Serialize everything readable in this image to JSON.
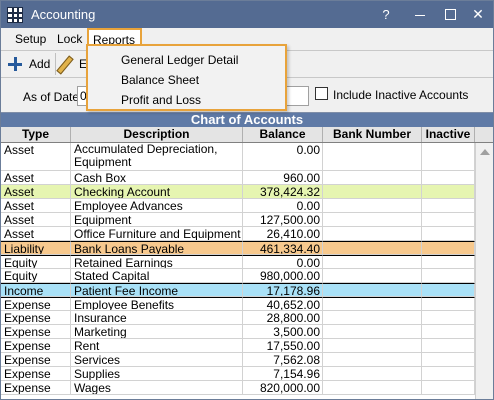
{
  "window": {
    "title": "Accounting"
  },
  "titlebar_buttons": {
    "help": "?",
    "close": "✕"
  },
  "menu": {
    "setup": "Setup",
    "lock": "Lock",
    "reports": "Reports"
  },
  "reports_menu": {
    "items": [
      "General Ledger Detail",
      "Balance Sheet",
      "Profit and Loss"
    ]
  },
  "toolbar": {
    "add_label": "Add",
    "edit_label_partial": "E"
  },
  "filter": {
    "as_of_label": "As of Date",
    "date_value_partial": "0",
    "include_inactive_label": "Include Inactive Accounts",
    "include_inactive_checked": false
  },
  "grid": {
    "title": "Chart of Accounts",
    "columns": [
      "Type",
      "Description",
      "Balance",
      "Bank Number",
      "Inactive"
    ],
    "rows": [
      {
        "type": "Asset",
        "description": "Accumulated Depreciation, Equipment",
        "balance": "0.00",
        "bank_number": "",
        "inactive": ""
      },
      {
        "type": "Asset",
        "description": "Cash Box",
        "balance": "960.00",
        "bank_number": "",
        "inactive": ""
      },
      {
        "type": "Asset",
        "description": "Checking Account",
        "balance": "378,424.32",
        "bank_number": "",
        "inactive": ""
      },
      {
        "type": "Asset",
        "description": "Employee Advances",
        "balance": "0.00",
        "bank_number": "",
        "inactive": ""
      },
      {
        "type": "Asset",
        "description": "Equipment",
        "balance": "127,500.00",
        "bank_number": "",
        "inactive": ""
      },
      {
        "type": "Asset",
        "description": "Office Furniture and Equipment",
        "balance": "26,410.00",
        "bank_number": "",
        "inactive": ""
      },
      {
        "type": "Liability",
        "description": "Bank Loans Payable",
        "balance": "461,334.40",
        "bank_number": "",
        "inactive": ""
      },
      {
        "type": "Equity",
        "description": "Retained Earnings",
        "balance": "0.00",
        "bank_number": "",
        "inactive": ""
      },
      {
        "type": "Equity",
        "description": "Stated Capital",
        "balance": "980,000.00",
        "bank_number": "",
        "inactive": ""
      },
      {
        "type": "Income",
        "description": "Patient Fee Income",
        "balance": "17,178.96",
        "bank_number": "",
        "inactive": ""
      },
      {
        "type": "Expense",
        "description": "Employee Benefits",
        "balance": "40,652.00",
        "bank_number": "",
        "inactive": ""
      },
      {
        "type": "Expense",
        "description": "Insurance",
        "balance": "28,800.00",
        "bank_number": "",
        "inactive": ""
      },
      {
        "type": "Expense",
        "description": "Marketing",
        "balance": "3,500.00",
        "bank_number": "",
        "inactive": ""
      },
      {
        "type": "Expense",
        "description": "Rent",
        "balance": "17,550.00",
        "bank_number": "",
        "inactive": ""
      },
      {
        "type": "Expense",
        "description": "Services",
        "balance": "7,562.08",
        "bank_number": "",
        "inactive": ""
      },
      {
        "type": "Expense",
        "description": "Supplies",
        "balance": "7,154.96",
        "bank_number": "",
        "inactive": ""
      },
      {
        "type": "Expense",
        "description": "Wages",
        "balance": "820,000.00",
        "bank_number": "",
        "inactive": ""
      }
    ]
  },
  "colors": {
    "titlebar": "#546b92",
    "grid_title": "#5f7aa6",
    "asset_highlight": "#e6f5b1",
    "liability_highlight": "#f7c98e",
    "income_highlight": "#a9e1f7",
    "menu_highlight_border": "#e8a33b"
  }
}
